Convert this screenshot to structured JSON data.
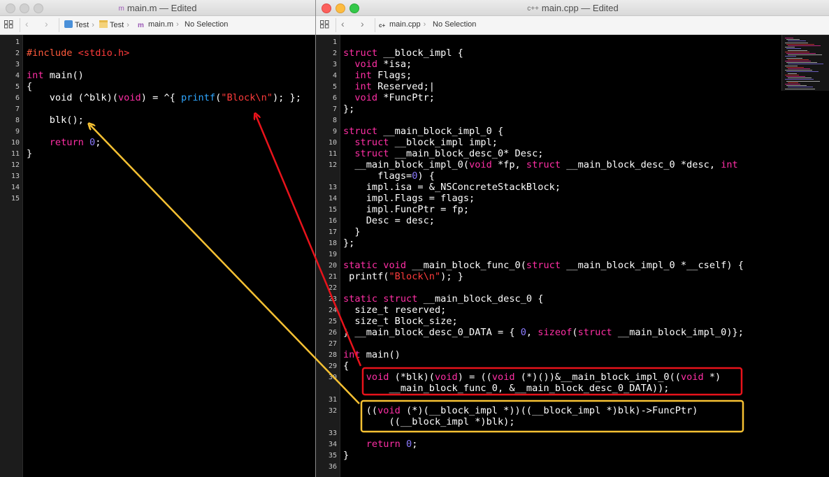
{
  "left_window": {
    "title": "main.m — Edited",
    "file_icon": "m",
    "breadcrumb": [
      "Test",
      "Test",
      "main.m",
      "No Selection"
    ],
    "lines": [
      {
        "n": "1",
        "t": []
      },
      {
        "n": "2",
        "t": [
          [
            "pp",
            "#include"
          ],
          [
            "",
            " "
          ],
          [
            "str",
            "<stdio.h>"
          ]
        ]
      },
      {
        "n": "3",
        "t": []
      },
      {
        "n": "4",
        "t": [
          [
            "kw",
            "int"
          ],
          [
            "",
            " main()"
          ]
        ]
      },
      {
        "n": "5",
        "t": [
          [
            "",
            "{"
          ]
        ]
      },
      {
        "n": "6",
        "t": [
          [
            "",
            "    void (^blk)("
          ],
          [
            "kw",
            "void"
          ],
          [
            "",
            ") = ^{ "
          ],
          [
            "fn",
            "printf"
          ],
          [
            "",
            "("
          ],
          [
            "str",
            "\"Block\\n\""
          ],
          [
            "",
            "); };"
          ]
        ]
      },
      {
        "n": "7",
        "t": []
      },
      {
        "n": "8",
        "t": [
          [
            "",
            "    blk();"
          ]
        ]
      },
      {
        "n": "9",
        "t": []
      },
      {
        "n": "10",
        "t": [
          [
            "",
            "    "
          ],
          [
            "kw",
            "return"
          ],
          [
            "",
            " "
          ],
          [
            "num",
            "0"
          ],
          [
            "",
            ";"
          ]
        ]
      },
      {
        "n": "11",
        "t": [
          [
            "",
            "}"
          ]
        ]
      },
      {
        "n": "12",
        "t": []
      },
      {
        "n": "13",
        "t": []
      },
      {
        "n": "14",
        "t": []
      },
      {
        "n": "15",
        "t": []
      }
    ]
  },
  "right_window": {
    "title": "main.cpp — Edited",
    "file_icon": "c++",
    "breadcrumb": [
      "main.cpp",
      "No Selection"
    ],
    "lines": [
      {
        "n": "1",
        "t": []
      },
      {
        "n": "2",
        "t": [
          [
            "kw",
            "struct"
          ],
          [
            "",
            " __block_impl {"
          ]
        ]
      },
      {
        "n": "3",
        "t": [
          [
            "",
            "  "
          ],
          [
            "kw",
            "void"
          ],
          [
            "",
            " *isa;"
          ]
        ]
      },
      {
        "n": "4",
        "t": [
          [
            "",
            "  "
          ],
          [
            "kw",
            "int"
          ],
          [
            "",
            " Flags;"
          ]
        ]
      },
      {
        "n": "5",
        "t": [
          [
            "",
            "  "
          ],
          [
            "kw",
            "int"
          ],
          [
            "",
            " Reserved;|"
          ]
        ]
      },
      {
        "n": "6",
        "t": [
          [
            "",
            "  "
          ],
          [
            "kw",
            "void"
          ],
          [
            "",
            " *FuncPtr;"
          ]
        ]
      },
      {
        "n": "7",
        "t": [
          [
            "",
            "};"
          ]
        ]
      },
      {
        "n": "8",
        "t": []
      },
      {
        "n": "9",
        "t": [
          [
            "kw",
            "struct"
          ],
          [
            "",
            " __main_block_impl_0 {"
          ]
        ]
      },
      {
        "n": "10",
        "t": [
          [
            "",
            "  "
          ],
          [
            "kw",
            "struct"
          ],
          [
            "",
            " __block_impl impl;"
          ]
        ]
      },
      {
        "n": "11",
        "t": [
          [
            "",
            "  "
          ],
          [
            "kw",
            "struct"
          ],
          [
            "",
            " __main_block_desc_0* Desc;"
          ]
        ]
      },
      {
        "n": "12",
        "t": [
          [
            "",
            "  __main_block_impl_0("
          ],
          [
            "kw",
            "void"
          ],
          [
            "",
            " *fp, "
          ],
          [
            "kw",
            "struct"
          ],
          [
            "",
            " __main_block_desc_0 *desc, "
          ],
          [
            "kw",
            "int"
          ]
        ]
      },
      {
        "n": "",
        "t": [
          [
            "",
            "      flags="
          ],
          [
            "num",
            "0"
          ],
          [
            "",
            ") {"
          ]
        ]
      },
      {
        "n": "13",
        "t": [
          [
            "",
            "    impl.isa = &_NSConcreteStackBlock;"
          ]
        ]
      },
      {
        "n": "14",
        "t": [
          [
            "",
            "    impl.Flags = flags;"
          ]
        ]
      },
      {
        "n": "15",
        "t": [
          [
            "",
            "    impl.FuncPtr = fp;"
          ]
        ]
      },
      {
        "n": "16",
        "t": [
          [
            "",
            "    Desc = desc;"
          ]
        ]
      },
      {
        "n": "17",
        "t": [
          [
            "",
            "  }"
          ]
        ]
      },
      {
        "n": "18",
        "t": [
          [
            "",
            "};"
          ]
        ]
      },
      {
        "n": "19",
        "t": []
      },
      {
        "n": "20",
        "t": [
          [
            "kw",
            "static"
          ],
          [
            "",
            " "
          ],
          [
            "kw",
            "void"
          ],
          [
            "",
            " __main_block_func_0("
          ],
          [
            "kw",
            "struct"
          ],
          [
            "",
            " __main_block_impl_0 *__cself) {"
          ]
        ]
      },
      {
        "n": "21",
        "t": [
          [
            "",
            " printf("
          ],
          [
            "str",
            "\"Block\\n\""
          ],
          [
            "",
            "); }"
          ]
        ]
      },
      {
        "n": "22",
        "t": []
      },
      {
        "n": "23",
        "t": [
          [
            "kw",
            "static"
          ],
          [
            "",
            " "
          ],
          [
            "kw",
            "struct"
          ],
          [
            "",
            " __main_block_desc_0 {"
          ]
        ]
      },
      {
        "n": "24",
        "t": [
          [
            "",
            "  size_t reserved;"
          ]
        ]
      },
      {
        "n": "25",
        "t": [
          [
            "",
            "  size_t Block_size;"
          ]
        ]
      },
      {
        "n": "26",
        "t": [
          [
            "",
            "} __main_block_desc_0_DATA = { "
          ],
          [
            "num",
            "0"
          ],
          [
            "",
            ", "
          ],
          [
            "kw",
            "sizeof"
          ],
          [
            "",
            "("
          ],
          [
            "kw",
            "struct"
          ],
          [
            "",
            " __main_block_impl_0)};"
          ]
        ]
      },
      {
        "n": "27",
        "t": []
      },
      {
        "n": "28",
        "t": [
          [
            "kw",
            "int"
          ],
          [
            "",
            " main()"
          ]
        ]
      },
      {
        "n": "29",
        "t": [
          [
            "",
            "{"
          ]
        ]
      },
      {
        "n": "30",
        "t": [
          [
            "",
            "    "
          ],
          [
            "kw",
            "void"
          ],
          [
            "",
            " (*blk)("
          ],
          [
            "kw",
            "void"
          ],
          [
            "",
            ") = (("
          ],
          [
            "kw",
            "void"
          ],
          [
            "",
            " (*)())&__main_block_impl_0(("
          ],
          [
            "kw",
            "void"
          ],
          [
            "",
            " *)"
          ]
        ]
      },
      {
        "n": "",
        "t": [
          [
            "",
            "        __main_block_func_0, &__main_block_desc_0_DATA));"
          ]
        ]
      },
      {
        "n": "31",
        "t": []
      },
      {
        "n": "32",
        "t": [
          [
            "",
            "    (("
          ],
          [
            "kw",
            "void"
          ],
          [
            "",
            " (*)(__block_impl *))((__block_impl *)blk)->FuncPtr)"
          ]
        ]
      },
      {
        "n": "",
        "t": [
          [
            "",
            "        ((__block_impl *)blk);"
          ]
        ]
      },
      {
        "n": "33",
        "t": []
      },
      {
        "n": "34",
        "t": [
          [
            "",
            "    "
          ],
          [
            "kw",
            "return"
          ],
          [
            "",
            " "
          ],
          [
            "num",
            "0"
          ],
          [
            "",
            ";"
          ]
        ]
      },
      {
        "n": "35",
        "t": [
          [
            "",
            "}"
          ]
        ]
      },
      {
        "n": "36",
        "t": []
      }
    ]
  },
  "colors": {
    "keyword": "#ff2fa5",
    "string": "#ff3b3b",
    "number": "#8c7bff",
    "preprocessor": "#ff5a3c",
    "function": "#2fa6ff",
    "red_annotation": "#e8131b",
    "yellow_annotation": "#f6c133"
  }
}
